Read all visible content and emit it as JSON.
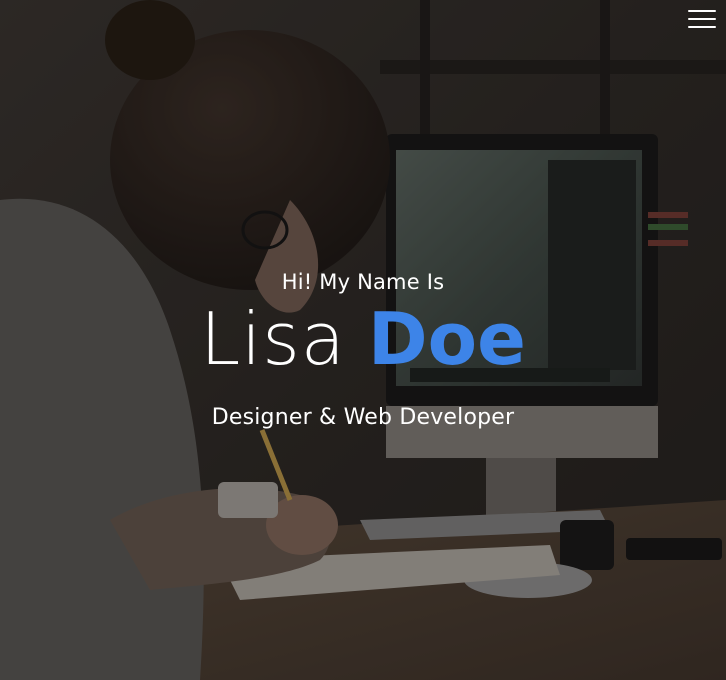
{
  "hero": {
    "greeting": "Hi! My Name Is",
    "first_name": "Lisa",
    "last_name": "Doe",
    "role": "Designer & Web Developer"
  },
  "nav": {
    "menu_icon": "hamburger-icon"
  },
  "colors": {
    "accent": "#3d84e8",
    "text": "#ffffff",
    "overlay": "#141210"
  }
}
